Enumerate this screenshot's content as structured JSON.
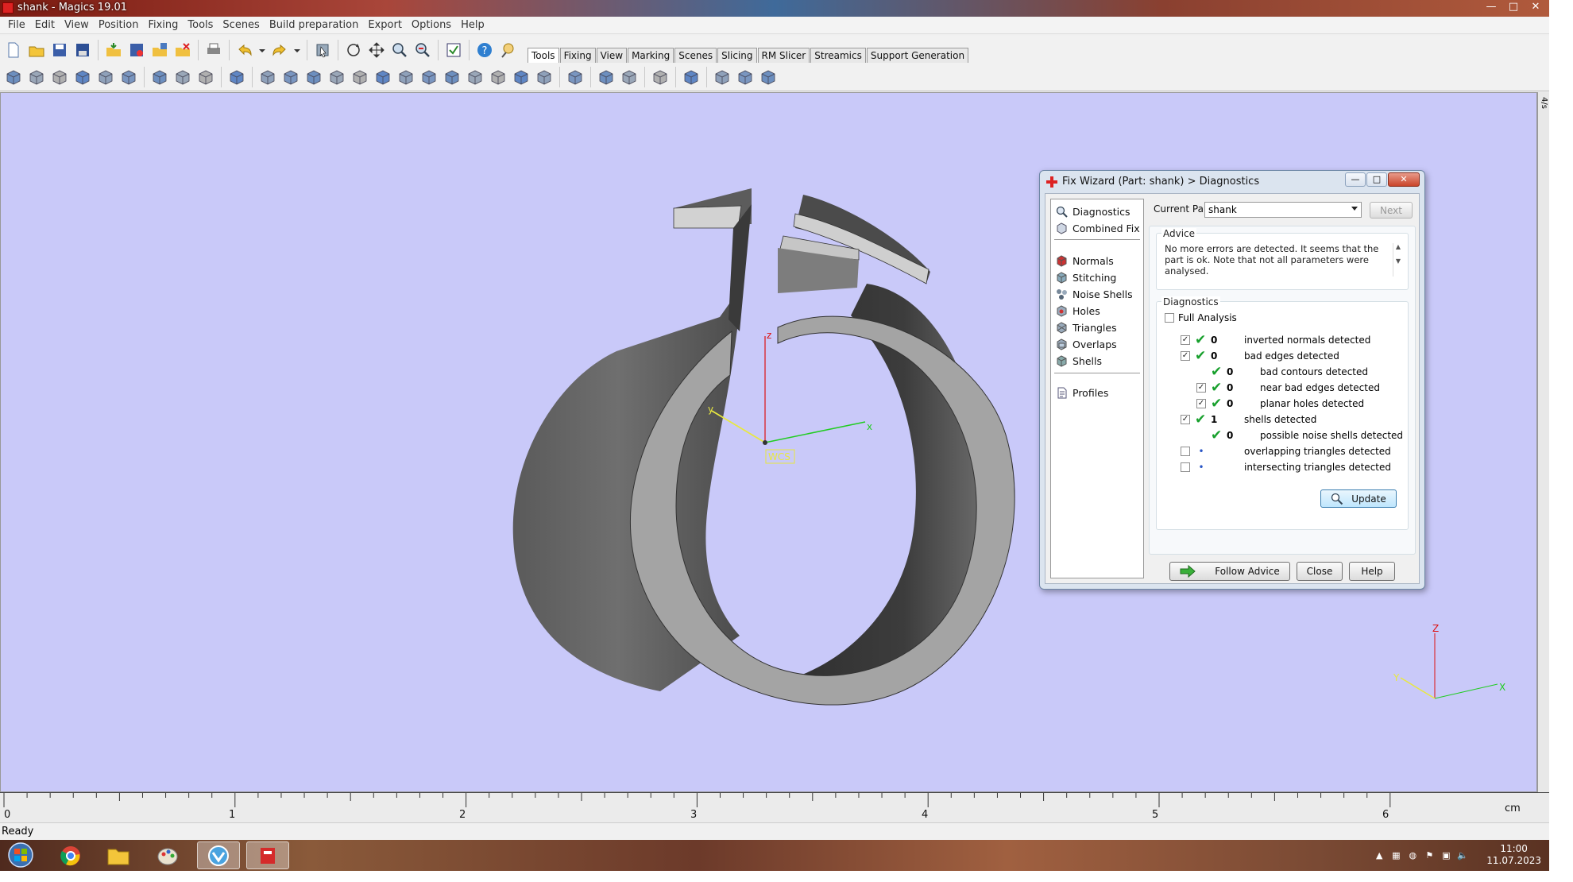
{
  "window": {
    "title": "shank - Magics 19.01",
    "controls": [
      "—",
      "□",
      "✕"
    ]
  },
  "menu": [
    "File",
    "Edit",
    "View",
    "Position",
    "Fixing",
    "Tools",
    "Scenes",
    "Build preparation",
    "Export",
    "Options",
    "Help"
  ],
  "tabs": [
    "Tools",
    "Fixing",
    "View",
    "Marking",
    "Scenes",
    "Slicing",
    "RM Slicer",
    "Streamics",
    "Support Generation"
  ],
  "viewport": {
    "axis_labels": {
      "z": "z",
      "x": "x",
      "y": "y",
      "wcs": "WCS"
    },
    "mini_axes": {
      "z": "Z",
      "x": "X",
      "y": "Y"
    },
    "colors": {
      "background": "#c9c9f9",
      "part": "#707070",
      "x_axis": "#22cc22",
      "y_axis": "#e8e840",
      "z_axis": "#dd1111"
    },
    "side_label": "4/s"
  },
  "ruler": {
    "ticks": [
      "0",
      "1",
      "2",
      "3",
      "4",
      "5",
      "6"
    ],
    "unit": "cm"
  },
  "status": "Ready",
  "wizard": {
    "title": "Fix Wizard (Part: shank) > Diagnostics",
    "nav_top": [
      "Diagnostics",
      "Combined Fix"
    ],
    "nav_items": [
      "Normals",
      "Stitching",
      "Noise Shells",
      "Holes",
      "Triangles",
      "Overlaps",
      "Shells"
    ],
    "nav_bottom": [
      "Profiles"
    ],
    "current_part_label": "Current Part:",
    "current_part_value": "shank",
    "next_label": "Next",
    "advice_title": "Advice",
    "advice_text": "No more errors are detected. It seems that the part is ok. Note that not all parameters were analysed.",
    "diagnostics_title": "Diagnostics",
    "full_analysis_label": "Full Analysis",
    "rows": [
      {
        "checked": "✓",
        "status": "✔",
        "count": "0",
        "label": "inverted normals detected"
      },
      {
        "checked": "✓",
        "status": "✔",
        "count": "0",
        "label": "bad edges detected"
      },
      {
        "checked": "",
        "status": "✔",
        "count": "0",
        "label": "bad contours detected"
      },
      {
        "checked": "✓",
        "status": "✔",
        "count": "0",
        "label": "near bad edges detected"
      },
      {
        "checked": "✓",
        "status": "✔",
        "count": "0",
        "label": "planar holes detected"
      },
      {
        "checked": "✓",
        "status": "✔",
        "count": "1",
        "label": "shells detected"
      },
      {
        "checked": "",
        "status": "✔",
        "count": "0",
        "label": "possible noise shells detected"
      },
      {
        "checked": "",
        "status": "•",
        "count": "",
        "label": "overlapping triangles detected"
      },
      {
        "checked": "",
        "status": "•",
        "count": "",
        "label": "intersecting triangles detected"
      }
    ],
    "update_label": "Update",
    "follow_advice_label": "Follow Advice",
    "close_label": "Close",
    "help_label": "Help"
  },
  "taskbar": {
    "time": "11:00",
    "date": "11.07.2023"
  }
}
